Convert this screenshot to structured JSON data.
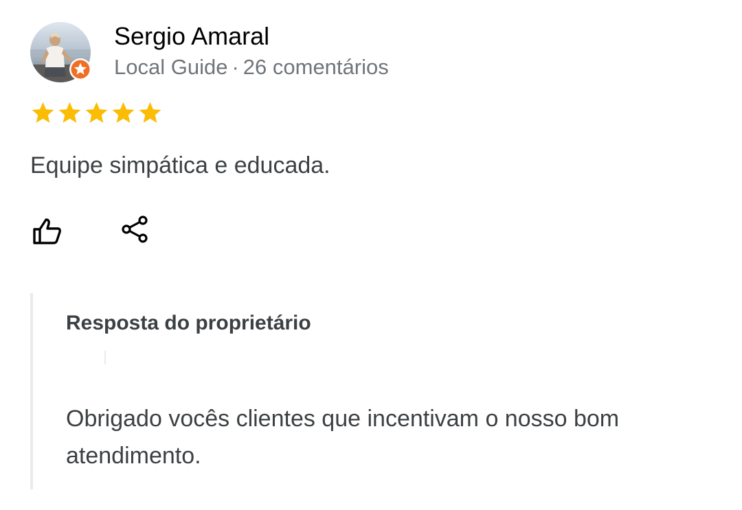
{
  "review": {
    "author": {
      "name": "Sergio Amaral",
      "badge": "Local Guide",
      "separator": "·",
      "review_count": "26 comentários",
      "avatar_icon": "user-photo",
      "badge_icon": "local-guide-star-icon"
    },
    "rating": {
      "value": 5,
      "max": 5,
      "star_color": "#fbbc04"
    },
    "text": "Equipe simpática e educada.",
    "actions": {
      "like_icon": "thumbs-up-icon",
      "share_icon": "share-icon"
    }
  },
  "owner_response": {
    "title": "Resposta do proprietário",
    "text": "Obrigado vocês clientes que incentivam o nosso bom atendimento."
  },
  "colors": {
    "name": "#000000",
    "meta": "#70757a",
    "body_text": "#3c4043",
    "badge": "#f06f24",
    "divider": "#e8eaed"
  }
}
